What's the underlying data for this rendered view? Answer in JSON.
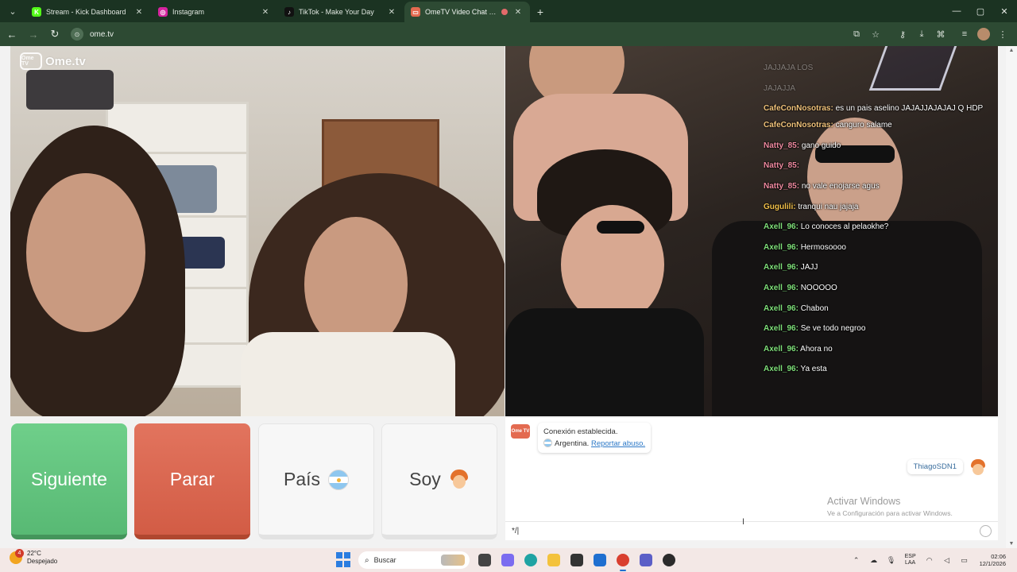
{
  "browser": {
    "tabs": [
      {
        "title": "Stream - Kick Dashboard",
        "favicon_color": "#53fc18",
        "favicon_glyph": "K",
        "active": false
      },
      {
        "title": "Instagram",
        "favicon_color": "#d6249f",
        "favicon_glyph": "◎",
        "active": false
      },
      {
        "title": "TikTok - Make Your Day",
        "favicon_color": "#111111",
        "favicon_glyph": "♪",
        "active": false
      },
      {
        "title": "OmeTV Video Chat — Ome",
        "favicon_color": "#e36a50",
        "favicon_glyph": "▭",
        "active": true
      }
    ],
    "new_tab_icon": "+",
    "url": "ome.tv"
  },
  "app": {
    "logo_mark": "Ome TV",
    "logo_word": "Ome.tv"
  },
  "stream_chat": [
    {
      "user": "",
      "text": "JAJJAJA LOS",
      "user_color": "#ffffff",
      "faded": true,
      "wrap": false
    },
    {
      "user": "",
      "text": "JAJAJJA",
      "user_color": "#ffffff",
      "faded": true,
      "wrap": false
    },
    {
      "user": "CafeConNosotras:",
      "text": "es un pais aselino JAJAJJAJAJAJ Q HDP",
      "user_color": "#f0c27a",
      "faded": false,
      "wrap": true
    },
    {
      "user": "CafeConNosotras:",
      "text": "canguro salame",
      "user_color": "#f0c27a",
      "faded": false,
      "wrap": false
    },
    {
      "user": "Natty_85:",
      "text": "gano guido",
      "user_color": "#f08aa0",
      "faded": false,
      "wrap": false
    },
    {
      "user": "Natty_85:",
      "text": "",
      "user_color": "#f08aa0",
      "faded": false,
      "wrap": false
    },
    {
      "user": "Natty_85:",
      "text": "no vale enojarse agus",
      "user_color": "#f08aa0",
      "faded": false,
      "wrap": false
    },
    {
      "user": "Gugulili:",
      "text": "tranqui nau jajaja",
      "user_color": "#f3c14a",
      "faded": false,
      "wrap": false
    },
    {
      "user": "Axell_96:",
      "text": "Lo conoces al pelaokhe?",
      "user_color": "#7fe07a",
      "faded": false,
      "wrap": false
    },
    {
      "user": "Axell_96:",
      "text": "Hermosoooo",
      "user_color": "#7fe07a",
      "faded": false,
      "wrap": false
    },
    {
      "user": "Axell_96:",
      "text": "JAJJ",
      "user_color": "#7fe07a",
      "faded": false,
      "wrap": false
    },
    {
      "user": "Axell_96:",
      "text": "NOOOOO",
      "user_color": "#7fe07a",
      "faded": false,
      "wrap": false
    },
    {
      "user": "Axell_96:",
      "text": "Chabon",
      "user_color": "#7fe07a",
      "faded": false,
      "wrap": false
    },
    {
      "user": "Axell_96:",
      "text": "Se ve todo negroo",
      "user_color": "#7fe07a",
      "faded": false,
      "wrap": false
    },
    {
      "user": "Axell_96:",
      "text": "Ahora no",
      "user_color": "#7fe07a",
      "faded": false,
      "wrap": false
    },
    {
      "user": "Axell_96:",
      "text": "Ya esta",
      "user_color": "#7fe07a",
      "faded": false,
      "wrap": false
    }
  ],
  "controls": {
    "next_label": "Siguiente",
    "stop_label": "Parar",
    "country_label": "País",
    "gender_label": "Soy",
    "next_color": "#6fcf8a",
    "stop_color": "#e2745e"
  },
  "text_chat": {
    "system_line1": "Conexión establecida.",
    "country_name": "Argentina.",
    "report_link": "Reportar abuso.",
    "partner_name": "ThiagoSDN1",
    "input_value": "*/|",
    "watermark_title": "Activar Windows",
    "watermark_sub": "Ve a Configuración para activar Windows."
  },
  "taskbar": {
    "weather_badge": "4",
    "weather_temp": "22°C",
    "weather_desc": "Despejado",
    "search_placeholder": "Buscar",
    "lang_top": "ESP",
    "lang_bottom": "LAA",
    "time": "02:06",
    "date": "12/1/2026",
    "apps": [
      {
        "name": "task-view",
        "color": "#444444"
      },
      {
        "name": "copilot",
        "color": "#7b6cf0"
      },
      {
        "name": "edge",
        "color": "#1fa3a3"
      },
      {
        "name": "file-explorer",
        "color": "#f3c23c"
      },
      {
        "name": "store",
        "color": "#333333"
      },
      {
        "name": "outlook",
        "color": "#1f6fd0"
      },
      {
        "name": "chrome",
        "color": "#d93f2f"
      },
      {
        "name": "teams",
        "color": "#5b5fc7"
      },
      {
        "name": "obs",
        "color": "#2b2b2b"
      }
    ]
  }
}
